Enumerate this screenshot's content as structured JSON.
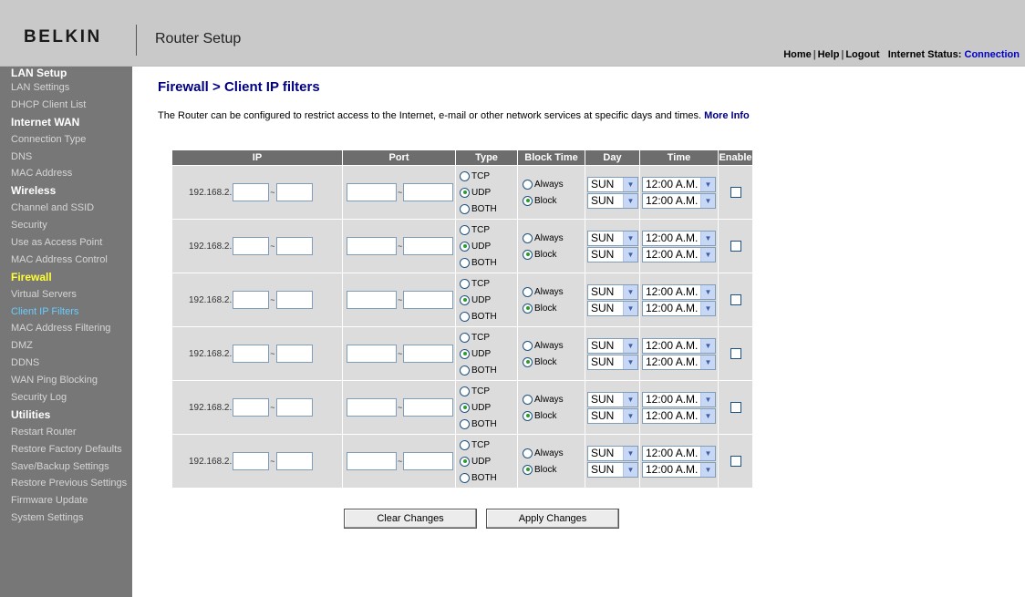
{
  "header": {
    "logo": "BELKIN",
    "app_title": "Router Setup",
    "links": [
      "Home",
      "Help",
      "Logout"
    ],
    "status_label": "Internet Status:",
    "status_value": "Connection"
  },
  "sidebar": {
    "sections": [
      {
        "title": "LAN Setup",
        "items": [
          "LAN Settings",
          "DHCP Client List"
        ]
      },
      {
        "title": "Internet WAN",
        "items": [
          "Connection Type",
          "DNS",
          "MAC Address"
        ]
      },
      {
        "title": "Wireless",
        "items": [
          "Channel and SSID",
          "Security",
          "Use as Access Point",
          "MAC Address Control"
        ]
      },
      {
        "title": "Firewall",
        "items": [
          "Virtual Servers",
          "Client IP Filters",
          "MAC Address Filtering",
          "DMZ",
          "DDNS",
          "WAN Ping Blocking",
          "Security Log"
        ]
      },
      {
        "title": "Utilities",
        "items": [
          "Restart Router",
          "Restore Factory Defaults",
          "Save/Backup Settings",
          "Restore Previous Settings",
          "Firmware Update",
          "System Settings"
        ]
      }
    ]
  },
  "page": {
    "heading": "Firewall > Client IP filters",
    "intro": "The Router can be configured to restrict access to the Internet, e-mail or other network services at specific days and times.",
    "more_info": "More Info"
  },
  "table": {
    "headers": {
      "ip": "IP",
      "port": "Port",
      "type": "Type",
      "block_time": "Block Time",
      "day": "Day",
      "time": "Time",
      "enable": "Enable"
    },
    "ip_prefix": "192.168.2.",
    "range_sep": "~",
    "type_options": [
      "TCP",
      "UDP",
      "BOTH"
    ],
    "block_options": [
      "Always",
      "Block"
    ],
    "rows": [
      {
        "type": "UDP",
        "block": "Block",
        "day1": "SUN",
        "day2": "SUN",
        "time1": "12:00 A.M.",
        "time2": "12:00 A.M.",
        "enabled": false
      },
      {
        "type": "UDP",
        "block": "Block",
        "day1": "SUN",
        "day2": "SUN",
        "time1": "12:00 A.M.",
        "time2": "12:00 A.M.",
        "enabled": false
      },
      {
        "type": "UDP",
        "block": "Block",
        "day1": "SUN",
        "day2": "SUN",
        "time1": "12:00 A.M.",
        "time2": "12:00 A.M.",
        "enabled": false
      },
      {
        "type": "UDP",
        "block": "Block",
        "day1": "SUN",
        "day2": "SUN",
        "time1": "12:00 A.M.",
        "time2": "12:00 A.M.",
        "enabled": false
      },
      {
        "type": "UDP",
        "block": "Block",
        "day1": "SUN",
        "day2": "SUN",
        "time1": "12:00 A.M.",
        "time2": "12:00 A.M.",
        "enabled": false
      },
      {
        "type": "UDP",
        "block": "Block",
        "day1": "SUN",
        "day2": "SUN",
        "time1": "12:00 A.M.",
        "time2": "12:00 A.M.",
        "enabled": false
      }
    ]
  },
  "buttons": {
    "clear": "Clear Changes",
    "apply": "Apply Changes"
  },
  "colors": {
    "header_bg": "#c9c9c9",
    "sidebar_bg": "#777777",
    "active_section": "#ffff33",
    "current_item": "#66ccff",
    "heading": "#000080",
    "table_header": "#6d6d6d",
    "row_bg": "#dcdcdc"
  }
}
